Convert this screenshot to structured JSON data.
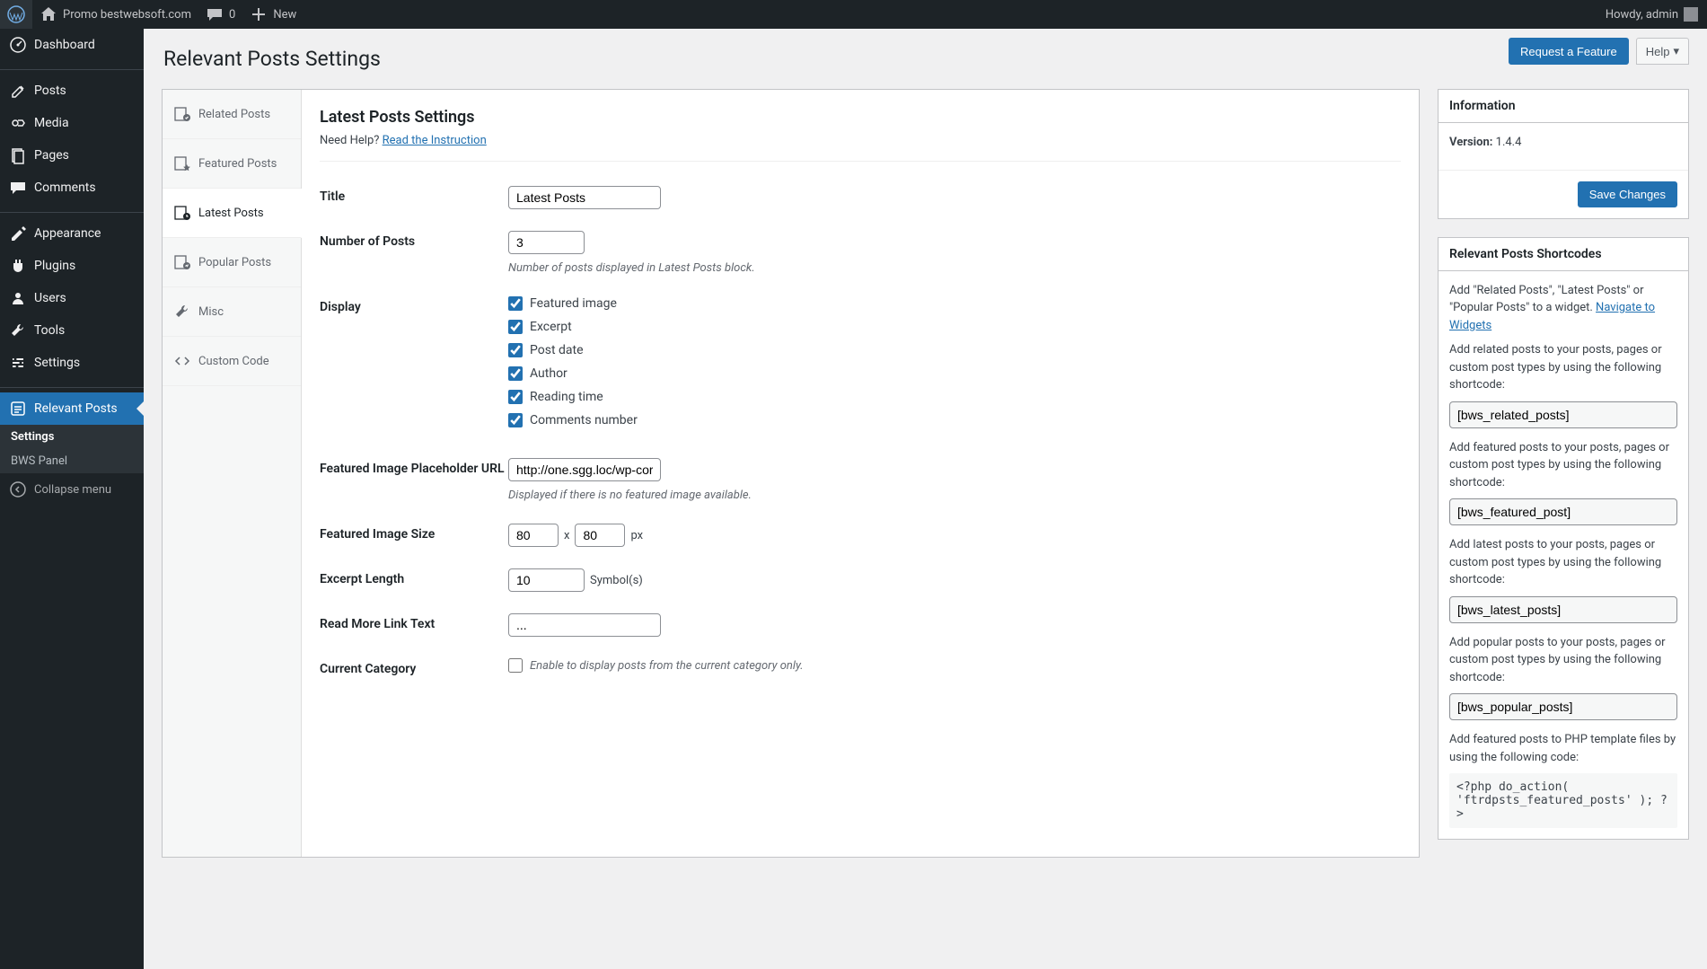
{
  "adminbar": {
    "site_name": "Promo bestwebsoft.com",
    "comments_count": "0",
    "new_label": "New",
    "howdy": "Howdy, admin"
  },
  "sidebar": {
    "items": [
      {
        "label": "Dashboard"
      },
      {
        "label": "Posts"
      },
      {
        "label": "Media"
      },
      {
        "label": "Pages"
      },
      {
        "label": "Comments"
      },
      {
        "label": "Appearance"
      },
      {
        "label": "Plugins"
      },
      {
        "label": "Users"
      },
      {
        "label": "Tools"
      },
      {
        "label": "Settings"
      },
      {
        "label": "Relevant Posts"
      }
    ],
    "submenu": [
      {
        "label": "Settings"
      },
      {
        "label": "BWS Panel"
      }
    ],
    "collapse": "Collapse menu"
  },
  "page": {
    "title": "Relevant Posts Settings",
    "request_feature": "Request a Feature",
    "help": "Help"
  },
  "tabs": [
    {
      "label": "Related Posts"
    },
    {
      "label": "Featured Posts"
    },
    {
      "label": "Latest Posts"
    },
    {
      "label": "Popular Posts"
    },
    {
      "label": "Misc"
    },
    {
      "label": "Custom Code"
    }
  ],
  "form": {
    "heading": "Latest Posts Settings",
    "help_prefix": "Need Help? ",
    "help_link": "Read the Instruction",
    "title_label": "Title",
    "title_value": "Latest Posts",
    "num_label": "Number of Posts",
    "num_value": "3",
    "num_desc": "Number of posts displayed in Latest Posts block.",
    "display_label": "Display",
    "display_options": [
      "Featured image",
      "Excerpt",
      "Post date",
      "Author",
      "Reading time",
      "Comments number"
    ],
    "placeholder_label": "Featured Image Placeholder URL",
    "placeholder_value": "http://one.sgg.loc/wp-cor",
    "placeholder_desc": "Displayed if there is no featured image available.",
    "size_label": "Featured Image Size",
    "size_w": "80",
    "size_x": "x",
    "size_h": "80",
    "size_unit": "px",
    "excerpt_label": "Excerpt Length",
    "excerpt_value": "10",
    "excerpt_unit": "Symbol(s)",
    "readmore_label": "Read More Link Text",
    "readmore_value": "...",
    "category_label": "Current Category",
    "category_desc": "Enable to display posts from the current category only."
  },
  "info_box": {
    "title": "Information",
    "version_label": "Version:",
    "version_value": "1.4.4",
    "save": "Save Changes"
  },
  "shortcodes_box": {
    "title": "Relevant Posts Shortcodes",
    "widget_text": "Add \"Related Posts\", \"Latest Posts\" or \"Popular Posts\" to a widget. ",
    "widget_link": "Navigate to Widgets",
    "related_text": "Add related posts to your posts, pages or custom post types by using the following shortcode:",
    "related_code": "[bws_related_posts]",
    "featured_text": "Add featured posts to your posts, pages or custom post types by using the following shortcode:",
    "featured_code": "[bws_featured_post]",
    "latest_text": "Add latest posts to your posts, pages or custom post types by using the following shortcode:",
    "latest_code": "[bws_latest_posts]",
    "popular_text": "Add popular posts to your posts, pages or custom post types by using the following shortcode:",
    "popular_code": "[bws_popular_posts]",
    "php_text": "Add featured posts to PHP template files by using the following code:",
    "php_code": "<?php do_action( 'ftrdpsts_featured_posts' ); ?>"
  }
}
